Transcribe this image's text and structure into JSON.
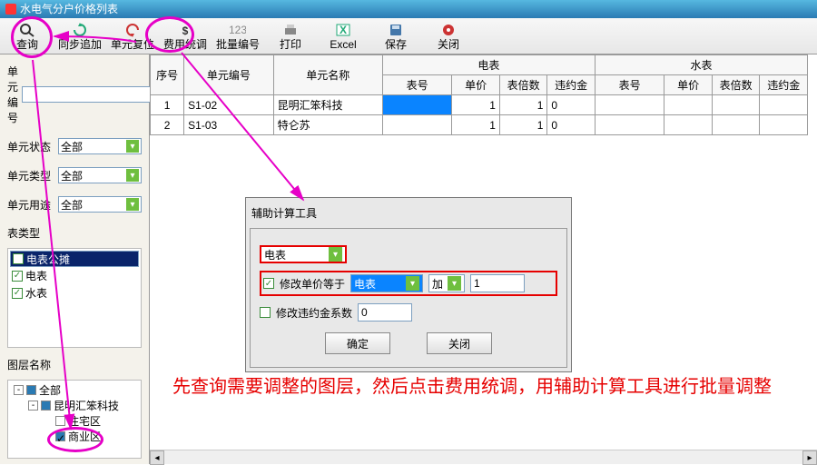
{
  "window": {
    "title": "水电气分户价格列表"
  },
  "toolbar": {
    "query": "查询",
    "sync": "同步追加",
    "unitpos": "单元复位",
    "feeadj": "费用统调",
    "batchno": "批量编号",
    "print": "打印",
    "excel": "Excel",
    "save": "保存",
    "close": "关闭"
  },
  "filters": {
    "unitNoLabel": "单元编号",
    "unitNo": "",
    "unitStateLabel": "单元状态",
    "unitState": "全部",
    "unitTypeLabel": "单元类型",
    "unitType": "全部",
    "unitUseLabel": "单元用途",
    "unitUse": "全部"
  },
  "meterTypeLabel": "表类型",
  "meterTypes": [
    {
      "label": "电表公摊",
      "checked": false,
      "selected": true
    },
    {
      "label": "电表",
      "checked": true,
      "selected": false
    },
    {
      "label": "水表",
      "checked": true,
      "selected": false
    }
  ],
  "layerLabel": "图层名称",
  "tree": {
    "root": "全部",
    "n1": "昆明汇笨科技",
    "n2": "住宅区",
    "n3": "商业区"
  },
  "grid": {
    "head": {
      "seq": "序号",
      "unitNo": "单元编号",
      "unitName": "单元名称",
      "elec": "电表",
      "water": "水表",
      "meterNo": "表号",
      "price": "单价",
      "mult": "表倍数",
      "penalty": "违约金"
    },
    "rows": [
      {
        "seq": "1",
        "no": "S1-02",
        "name": "昆明汇笨科技",
        "e_no": "",
        "e_price": "1",
        "e_mult": "1",
        "e_pen": "0"
      },
      {
        "seq": "2",
        "no": "S1-03",
        "name": "特仑苏",
        "e_no": "",
        "e_price": "1",
        "e_mult": "1",
        "e_pen": "0"
      }
    ]
  },
  "dialog": {
    "title": "辅助计算工具",
    "meterSel": "电表",
    "cb1Label": "修改单价等于",
    "field": "电表",
    "op": "加",
    "val": "1",
    "cb2Label": "修改违约金系数",
    "val2": "0",
    "ok": "确定",
    "close": "关闭"
  },
  "annotation": "先查询需要调整的图层，然后点击费用统调，用辅助计算工具进行批量调整",
  "colors": {
    "accent": "#2a7ab3",
    "highlight": "#e600c7",
    "red": "#e60000"
  }
}
